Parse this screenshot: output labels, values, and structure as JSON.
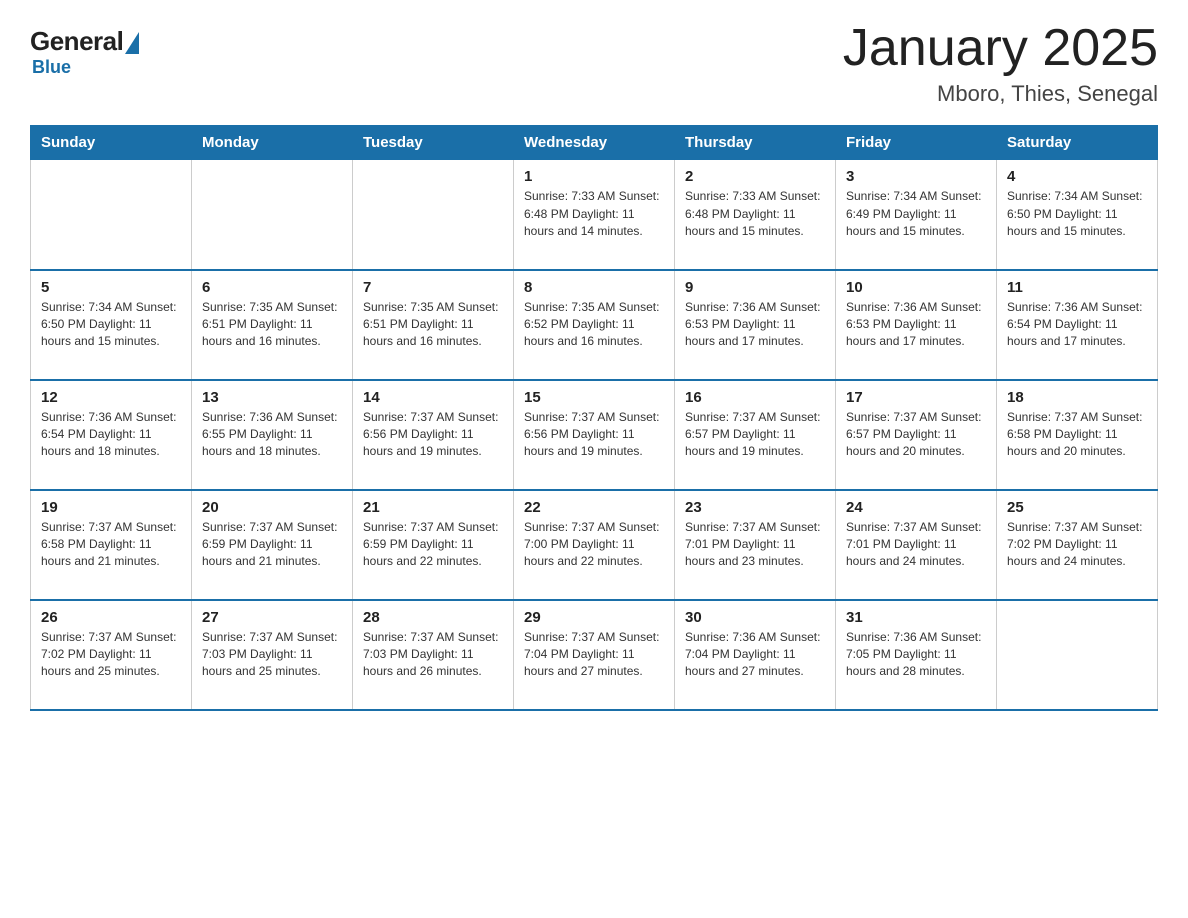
{
  "header": {
    "logo": {
      "general": "General",
      "blue": "Blue"
    },
    "title": "January 2025",
    "subtitle": "Mboro, Thies, Senegal"
  },
  "days_of_week": [
    "Sunday",
    "Monday",
    "Tuesday",
    "Wednesday",
    "Thursday",
    "Friday",
    "Saturday"
  ],
  "weeks": [
    [
      {
        "day": "",
        "info": ""
      },
      {
        "day": "",
        "info": ""
      },
      {
        "day": "",
        "info": ""
      },
      {
        "day": "1",
        "info": "Sunrise: 7:33 AM\nSunset: 6:48 PM\nDaylight: 11 hours\nand 14 minutes."
      },
      {
        "day": "2",
        "info": "Sunrise: 7:33 AM\nSunset: 6:48 PM\nDaylight: 11 hours\nand 15 minutes."
      },
      {
        "day": "3",
        "info": "Sunrise: 7:34 AM\nSunset: 6:49 PM\nDaylight: 11 hours\nand 15 minutes."
      },
      {
        "day": "4",
        "info": "Sunrise: 7:34 AM\nSunset: 6:50 PM\nDaylight: 11 hours\nand 15 minutes."
      }
    ],
    [
      {
        "day": "5",
        "info": "Sunrise: 7:34 AM\nSunset: 6:50 PM\nDaylight: 11 hours\nand 15 minutes."
      },
      {
        "day": "6",
        "info": "Sunrise: 7:35 AM\nSunset: 6:51 PM\nDaylight: 11 hours\nand 16 minutes."
      },
      {
        "day": "7",
        "info": "Sunrise: 7:35 AM\nSunset: 6:51 PM\nDaylight: 11 hours\nand 16 minutes."
      },
      {
        "day": "8",
        "info": "Sunrise: 7:35 AM\nSunset: 6:52 PM\nDaylight: 11 hours\nand 16 minutes."
      },
      {
        "day": "9",
        "info": "Sunrise: 7:36 AM\nSunset: 6:53 PM\nDaylight: 11 hours\nand 17 minutes."
      },
      {
        "day": "10",
        "info": "Sunrise: 7:36 AM\nSunset: 6:53 PM\nDaylight: 11 hours\nand 17 minutes."
      },
      {
        "day": "11",
        "info": "Sunrise: 7:36 AM\nSunset: 6:54 PM\nDaylight: 11 hours\nand 17 minutes."
      }
    ],
    [
      {
        "day": "12",
        "info": "Sunrise: 7:36 AM\nSunset: 6:54 PM\nDaylight: 11 hours\nand 18 minutes."
      },
      {
        "day": "13",
        "info": "Sunrise: 7:36 AM\nSunset: 6:55 PM\nDaylight: 11 hours\nand 18 minutes."
      },
      {
        "day": "14",
        "info": "Sunrise: 7:37 AM\nSunset: 6:56 PM\nDaylight: 11 hours\nand 19 minutes."
      },
      {
        "day": "15",
        "info": "Sunrise: 7:37 AM\nSunset: 6:56 PM\nDaylight: 11 hours\nand 19 minutes."
      },
      {
        "day": "16",
        "info": "Sunrise: 7:37 AM\nSunset: 6:57 PM\nDaylight: 11 hours\nand 19 minutes."
      },
      {
        "day": "17",
        "info": "Sunrise: 7:37 AM\nSunset: 6:57 PM\nDaylight: 11 hours\nand 20 minutes."
      },
      {
        "day": "18",
        "info": "Sunrise: 7:37 AM\nSunset: 6:58 PM\nDaylight: 11 hours\nand 20 minutes."
      }
    ],
    [
      {
        "day": "19",
        "info": "Sunrise: 7:37 AM\nSunset: 6:58 PM\nDaylight: 11 hours\nand 21 minutes."
      },
      {
        "day": "20",
        "info": "Sunrise: 7:37 AM\nSunset: 6:59 PM\nDaylight: 11 hours\nand 21 minutes."
      },
      {
        "day": "21",
        "info": "Sunrise: 7:37 AM\nSunset: 6:59 PM\nDaylight: 11 hours\nand 22 minutes."
      },
      {
        "day": "22",
        "info": "Sunrise: 7:37 AM\nSunset: 7:00 PM\nDaylight: 11 hours\nand 22 minutes."
      },
      {
        "day": "23",
        "info": "Sunrise: 7:37 AM\nSunset: 7:01 PM\nDaylight: 11 hours\nand 23 minutes."
      },
      {
        "day": "24",
        "info": "Sunrise: 7:37 AM\nSunset: 7:01 PM\nDaylight: 11 hours\nand 24 minutes."
      },
      {
        "day": "25",
        "info": "Sunrise: 7:37 AM\nSunset: 7:02 PM\nDaylight: 11 hours\nand 24 minutes."
      }
    ],
    [
      {
        "day": "26",
        "info": "Sunrise: 7:37 AM\nSunset: 7:02 PM\nDaylight: 11 hours\nand 25 minutes."
      },
      {
        "day": "27",
        "info": "Sunrise: 7:37 AM\nSunset: 7:03 PM\nDaylight: 11 hours\nand 25 minutes."
      },
      {
        "day": "28",
        "info": "Sunrise: 7:37 AM\nSunset: 7:03 PM\nDaylight: 11 hours\nand 26 minutes."
      },
      {
        "day": "29",
        "info": "Sunrise: 7:37 AM\nSunset: 7:04 PM\nDaylight: 11 hours\nand 27 minutes."
      },
      {
        "day": "30",
        "info": "Sunrise: 7:36 AM\nSunset: 7:04 PM\nDaylight: 11 hours\nand 27 minutes."
      },
      {
        "day": "31",
        "info": "Sunrise: 7:36 AM\nSunset: 7:05 PM\nDaylight: 11 hours\nand 28 minutes."
      },
      {
        "day": "",
        "info": ""
      }
    ]
  ]
}
